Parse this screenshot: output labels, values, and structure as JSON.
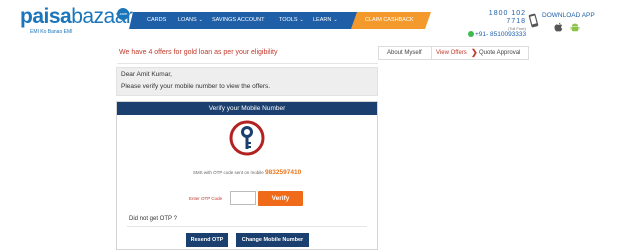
{
  "brand": {
    "name_part1": "paisa",
    "name_part2": "bazaar",
    "badge": ".com",
    "tagline": "EMI Ko Banao EMI"
  },
  "nav": {
    "items": [
      {
        "label": "CARDS",
        "has_dropdown": false
      },
      {
        "label": "LOANS",
        "has_dropdown": true
      },
      {
        "label": "SAVINGS ACCOUNT",
        "has_dropdown": false
      },
      {
        "label": "TOOLS",
        "has_dropdown": true
      },
      {
        "label": "LEARN",
        "has_dropdown": true
      }
    ],
    "cta": "CLAIM CASHBACK",
    "dropdown_glyph": "⌄",
    "colors": {
      "primary": "#1f5fa8",
      "cta": "#f49a2c"
    }
  },
  "contact": {
    "phone": "1800 102 7718",
    "phone_note": "(Toll Free)",
    "whatsapp": "+91- 8510093333",
    "download_label": "DOWNLOAD APP"
  },
  "offers": {
    "message": "We have 4 offers for gold loan as per your eligibility"
  },
  "steps": {
    "items": [
      "About Myself",
      "View Offers",
      "Quote Approval"
    ],
    "active_index": 1,
    "arrow": "❯"
  },
  "greeting": {
    "line1": "Dear Amit Kumar,",
    "line2": "Please verify your mobile number to view the offers."
  },
  "verify": {
    "title": "Verify your Mobile Number",
    "sms_prefix": "SMS with OTP code sent on mobile",
    "mobile_number": "9832597410",
    "otp_label": "Enter OTP Code",
    "otp_value": "",
    "verify_button": "Verify",
    "not_received": "Did not get OTP ?",
    "resend_button": "Resend OTP",
    "change_button": "Change Mobile Number",
    "colors": {
      "header": "#1b3f6e",
      "verify": "#ef6b1a",
      "key_ring": "#b22222"
    }
  }
}
